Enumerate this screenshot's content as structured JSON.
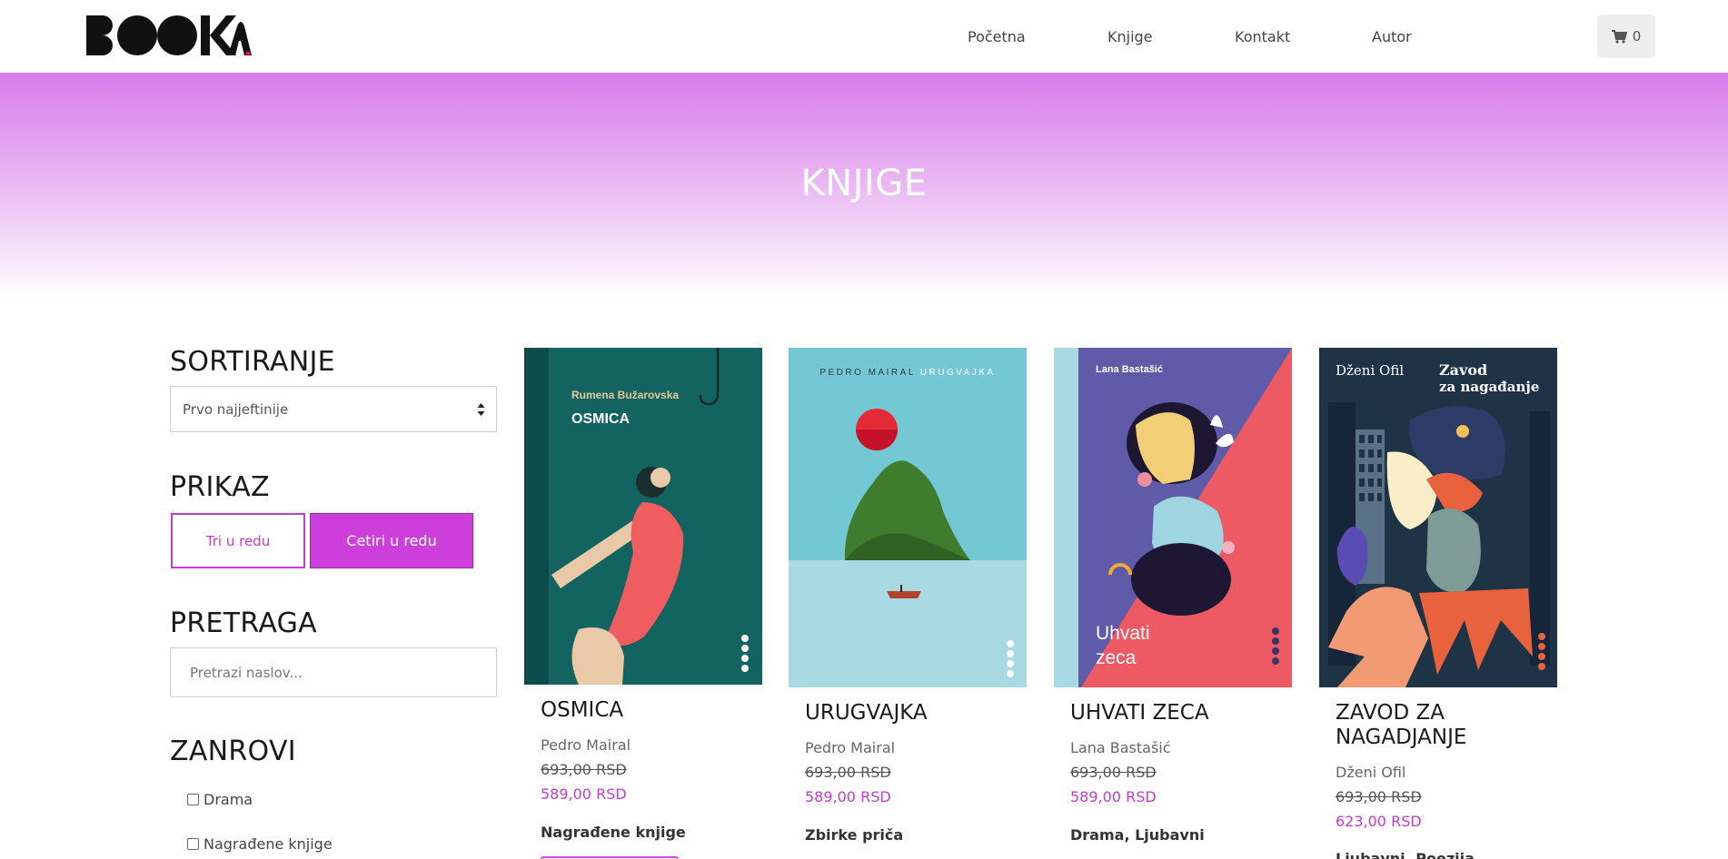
{
  "header": {
    "logo_text": "BOOKA.",
    "nav": [
      {
        "label": "Početna"
      },
      {
        "label": "Knjige"
      },
      {
        "label": "Kontakt"
      },
      {
        "label": "Autor"
      }
    ],
    "cart_count": "0"
  },
  "hero": {
    "title": "KNJIGE"
  },
  "sidebar": {
    "sort_title": "SORTIRANJE",
    "sort_selected": "Prvo najjeftinije",
    "view_title": "PRIKAZ",
    "view_three": "Tri u redu",
    "view_four": "Cetiri u redu",
    "search_title": "PRETRAGA",
    "search_placeholder": "Pretrazi naslov...",
    "genres_title": "ZANROVI",
    "genres": [
      {
        "label": "Drama"
      },
      {
        "label": "Nagrađene knjige"
      }
    ]
  },
  "products": [
    {
      "title": "OSMICA",
      "author": "Pedro Mairal",
      "old_price": "693,00 RSD",
      "price": "589,00 RSD",
      "genres": "Nagrađene knjige",
      "cover_author": "Rumena Bužarovska",
      "cover_title": "OSMICA"
    },
    {
      "title": "URUGVAJKA",
      "author": "Pedro Mairal",
      "old_price": "693,00 RSD",
      "price": "589,00 RSD",
      "genres": "Zbirke priča",
      "cover_author": "PEDRO MAIRAL",
      "cover_title": "URUGVAJKA"
    },
    {
      "title": "UHVATI ZECA",
      "author": "Lana Bastašić",
      "old_price": "693,00 RSD",
      "price": "589,00 RSD",
      "genres": "Drama, Ljubavni",
      "cover_author": "Lana Bastašić",
      "cover_title_line1": "Uhvati",
      "cover_title_line2": "zeca"
    },
    {
      "title": "ZAVOD ZA NAGADJANJE",
      "author": "Dženi Ofil",
      "old_price": "693,00 RSD",
      "price": "623,00 RSD",
      "genres": "Ljubavni, Poezija",
      "cover_author": "Dženi Ofil",
      "cover_title_line1": "Zavod",
      "cover_title_line2": "za nagađanje"
    }
  ],
  "colors": {
    "accent": "#cc3fdb",
    "hero_top": "#d97ceb"
  }
}
